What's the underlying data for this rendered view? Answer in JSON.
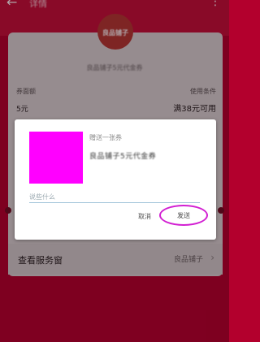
{
  "header": {
    "title": "详情",
    "back_icon": "arrow-left-icon",
    "more_icon": "more-vertical-icon"
  },
  "coupon": {
    "logo_text": "良品铺子",
    "name": "良品铺子5元代金券",
    "threshold_label": "券面额",
    "condition_label": "使用条件",
    "amount": "5元",
    "condition": "满38元可用"
  },
  "service": {
    "label": "查看服务窗",
    "shop": "良品铺子",
    "chevron_icon": "chevron-right-icon"
  },
  "dialog": {
    "thumb_color": "#ff00ff",
    "title": "赠送一张券",
    "description": "良品铺子5元代金券",
    "message_placeholder": "说些什么",
    "cancel_label": "取消",
    "send_label": "发送"
  },
  "colors": {
    "background": "#b3002d",
    "highlight": "#d21fd2"
  }
}
